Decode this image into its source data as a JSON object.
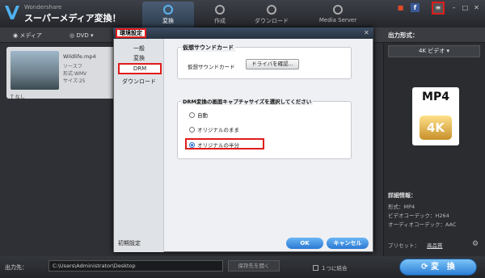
{
  "app": {
    "brand_small": "Wondershare",
    "brand_big": "スーパーメディア変換！"
  },
  "tabs": [
    {
      "label": "変換"
    },
    {
      "label": "作成"
    },
    {
      "label": "ダウンロード"
    },
    {
      "label": "Media Server"
    }
  ],
  "toolbar": {
    "media": "メディア",
    "dvd": "DVD"
  },
  "output": {
    "label": "出力形式：",
    "format": "4K ビデオ",
    "badge_top": "MP4",
    "badge_bottom": "4K"
  },
  "details": {
    "title": "詳細情報：",
    "lines": [
      "形式：MP4",
      "ビデオコーデック：H264",
      "オーディオコーデック：AAC"
    ],
    "preset_label": "プリセット：",
    "preset_value": "高品質"
  },
  "file": {
    "name": "Wildlife.mp4",
    "info": [
      "ソースフ",
      "形式:WMV",
      "サイズ:25"
    ],
    "none": "なし"
  },
  "dialog": {
    "title": "環境設定",
    "nav": [
      "一般",
      "変換",
      "DRM",
      "ダウンロード"
    ],
    "initial": "初期設定",
    "group1_title": "仮想サウンドカード",
    "vsc_label": "仮想サウンドカード",
    "driver_button": "ドライバを確認...",
    "group2_title": "DRM変換の画面キャプチャサイズを選択してください",
    "options": [
      "自動",
      "オリジナルのまま",
      "オリジナルの半分"
    ],
    "ok": "OK",
    "cancel": "キャンセル"
  },
  "bottom": {
    "out_label": "出力先：",
    "path": "C:\\Users\\Administrator\\Desktop",
    "open": "保存先を開く",
    "merge": "１つに結合",
    "convert": "変　換"
  }
}
